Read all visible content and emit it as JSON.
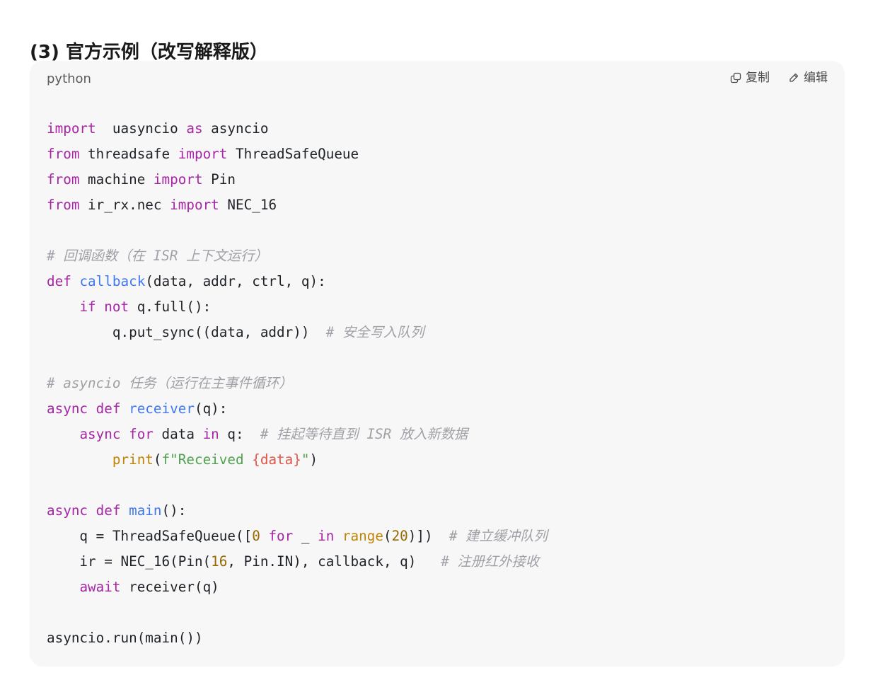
{
  "heading": "(3) 官方示例（改写解释版）",
  "code_block": {
    "language": "python",
    "toolbar": {
      "copy_label": "复制",
      "copy_icon": "copy-icon",
      "edit_label": "编辑",
      "edit_icon": "pencil-icon"
    },
    "lines": [
      [
        [
          "kw",
          "import"
        ],
        [
          "",
          "  uasyncio "
        ],
        [
          "kw",
          "as"
        ],
        [
          "",
          " asyncio"
        ]
      ],
      [
        [
          "kw",
          "from"
        ],
        [
          "",
          " threadsafe "
        ],
        [
          "kw",
          "import"
        ],
        [
          "",
          " ThreadSafeQueue"
        ]
      ],
      [
        [
          "kw",
          "from"
        ],
        [
          "",
          " machine "
        ],
        [
          "kw",
          "import"
        ],
        [
          "",
          " Pin"
        ]
      ],
      [
        [
          "kw",
          "from"
        ],
        [
          "",
          " ir_rx.nec "
        ],
        [
          "kw",
          "import"
        ],
        [
          "",
          " NEC_16"
        ]
      ],
      [],
      [
        [
          "cm",
          "# 回调函数（在 ISR 上下文运行）"
        ]
      ],
      [
        [
          "kw",
          "def"
        ],
        [
          "",
          " "
        ],
        [
          "fn",
          "callback"
        ],
        [
          "",
          "(data, addr, ctrl, q):"
        ]
      ],
      [
        [
          "",
          "    "
        ],
        [
          "kw",
          "if"
        ],
        [
          "",
          " "
        ],
        [
          "kw",
          "not"
        ],
        [
          "",
          " q.full():"
        ]
      ],
      [
        [
          "",
          "        q.put_sync((data, addr))  "
        ],
        [
          "cm",
          "# 安全写入队列"
        ]
      ],
      [],
      [
        [
          "cm",
          "# asyncio 任务（运行在主事件循环）"
        ]
      ],
      [
        [
          "kw",
          "async"
        ],
        [
          "",
          " "
        ],
        [
          "kw",
          "def"
        ],
        [
          "",
          " "
        ],
        [
          "fn",
          "receiver"
        ],
        [
          "",
          "(q):"
        ]
      ],
      [
        [
          "",
          "    "
        ],
        [
          "kw",
          "async"
        ],
        [
          "",
          " "
        ],
        [
          "kw",
          "for"
        ],
        [
          "",
          " data "
        ],
        [
          "kw",
          "in"
        ],
        [
          "",
          " q:  "
        ],
        [
          "cm",
          "# 挂起等待直到 ISR 放入新数据"
        ]
      ],
      [
        [
          "",
          "        "
        ],
        [
          "bi",
          "print"
        ],
        [
          "",
          "("
        ],
        [
          "str",
          "f\"Received "
        ],
        [
          "interp",
          "{data}"
        ],
        [
          "str",
          "\""
        ],
        [
          "",
          ")"
        ]
      ],
      [],
      [
        [
          "kw",
          "async"
        ],
        [
          "",
          " "
        ],
        [
          "kw",
          "def"
        ],
        [
          "",
          " "
        ],
        [
          "fn",
          "main"
        ],
        [
          "",
          "():"
        ]
      ],
      [
        [
          "",
          "    q = ThreadSafeQueue(["
        ],
        [
          "num",
          "0"
        ],
        [
          "",
          " "
        ],
        [
          "kw",
          "for"
        ],
        [
          "",
          " _ "
        ],
        [
          "kw",
          "in"
        ],
        [
          "",
          " "
        ],
        [
          "bi",
          "range"
        ],
        [
          "",
          "("
        ],
        [
          "num",
          "20"
        ],
        [
          "",
          ")])  "
        ],
        [
          "cm",
          "# 建立缓冲队列"
        ]
      ],
      [
        [
          "",
          "    ir = NEC_16(Pin("
        ],
        [
          "num",
          "16"
        ],
        [
          "",
          ", Pin.IN), callback, q)   "
        ],
        [
          "cm",
          "# 注册红外接收"
        ]
      ],
      [
        [
          "",
          "    "
        ],
        [
          "kw",
          "await"
        ],
        [
          "",
          " receiver(q)"
        ]
      ],
      [],
      [
        [
          "",
          "asyncio.run(main())"
        ]
      ]
    ]
  }
}
